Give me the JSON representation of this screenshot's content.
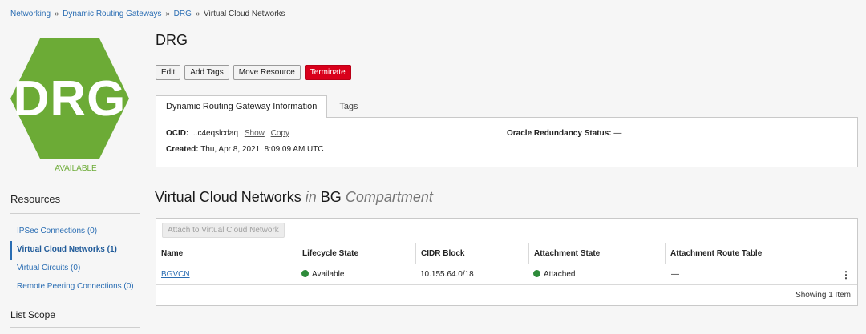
{
  "breadcrumb": {
    "items": [
      "Networking",
      "Dynamic Routing Gateways",
      "DRG"
    ],
    "separator": "»",
    "current": "Virtual Cloud Networks"
  },
  "resource_icon": {
    "label": "DRG",
    "shape": "hexagon",
    "color": "#6cab36",
    "status": "AVAILABLE"
  },
  "sidebar": {
    "title": "Resources",
    "items": [
      {
        "label": "IPSec Connections (0)",
        "active": false
      },
      {
        "label": "Virtual Cloud Networks (1)",
        "active": true
      },
      {
        "label": "Virtual Circuits (0)",
        "active": false
      },
      {
        "label": "Remote Peering Connections (0)",
        "active": false
      }
    ],
    "scope_title": "List Scope"
  },
  "header": {
    "title": "DRG",
    "buttons": {
      "edit": "Edit",
      "add_tags": "Add Tags",
      "move": "Move Resource",
      "terminate": "Terminate"
    }
  },
  "tabs": {
    "info": "Dynamic Routing Gateway Information",
    "tags": "Tags"
  },
  "info": {
    "ocid_label": "OCID:",
    "ocid_value": "...c4eqslcdaq",
    "show": "Show",
    "copy": "Copy",
    "created_label": "Created:",
    "created_value": "Thu, Apr 8, 2021, 8:09:09 AM UTC",
    "redundancy_label": "Oracle Redundancy Status:",
    "redundancy_value": "—"
  },
  "section": {
    "title": "Virtual Cloud Networks",
    "in": "in",
    "compartment": "BG",
    "compartment_word": "Compartment"
  },
  "table": {
    "attach_button": "Attach to Virtual Cloud Network",
    "columns": [
      "Name",
      "Lifecycle State",
      "CIDR Block",
      "Attachment State",
      "Attachment Route Table"
    ],
    "rows": [
      {
        "name": "BGVCN",
        "lifecycle": "Available",
        "cidr": "10.155.64.0/18",
        "attachment": "Attached",
        "route_table": "—"
      }
    ],
    "footer": "Showing 1 Item"
  },
  "colors": {
    "link": "#2a6db3",
    "terminate": "#d9001b",
    "available": "#6cab36",
    "status_dot": "#2e8b3a"
  }
}
